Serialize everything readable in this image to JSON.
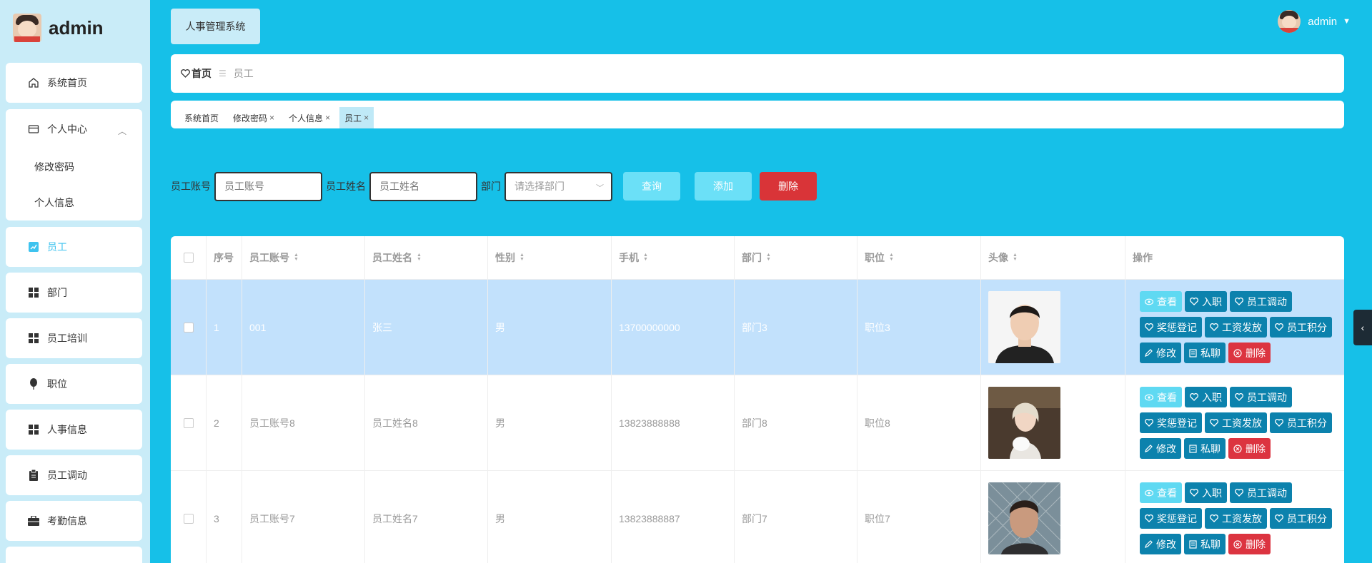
{
  "app": {
    "title": "admin",
    "system_tab": "人事管理系统"
  },
  "user": {
    "name": "admin"
  },
  "sidebar": {
    "items": [
      {
        "label": "系统首页",
        "icon": "home-icon"
      },
      {
        "label": "个人中心",
        "icon": "card-icon",
        "expanded": true,
        "children": [
          "修改密码",
          "个人信息"
        ]
      },
      {
        "label": "员工",
        "icon": "chart-icon",
        "active": true
      },
      {
        "label": "部门",
        "icon": "grid-icon"
      },
      {
        "label": "员工培训",
        "icon": "grid-icon"
      },
      {
        "label": "职位",
        "icon": "balloon-icon"
      },
      {
        "label": "人事信息",
        "icon": "grid-icon"
      },
      {
        "label": "员工调动",
        "icon": "clipboard-icon"
      },
      {
        "label": "考勤信息",
        "icon": "briefcase-icon"
      }
    ]
  },
  "breadcrumb": {
    "home": "首页",
    "separator": "☰",
    "current": "员工"
  },
  "tags": [
    {
      "label": "系统首页",
      "closable": false
    },
    {
      "label": "修改密码",
      "closable": true
    },
    {
      "label": "个人信息",
      "closable": true
    },
    {
      "label": "员工",
      "closable": true,
      "active": true
    }
  ],
  "search": {
    "account_label": "员工账号",
    "account_placeholder": "员工账号",
    "name_label": "员工姓名",
    "name_placeholder": "员工姓名",
    "dept_label": "部门",
    "dept_placeholder": "请选择部门",
    "query_btn": "查询",
    "add_btn": "添加",
    "delete_btn": "删除"
  },
  "table": {
    "columns": [
      "序号",
      "员工账号",
      "员工姓名",
      "性别",
      "手机",
      "部门",
      "职位",
      "头像",
      "操作"
    ],
    "rows": [
      {
        "idx": "1",
        "account": "001",
        "name": "张三",
        "gender": "男",
        "phone": "13700000000",
        "dept": "部门3",
        "position": "职位3",
        "selected": true
      },
      {
        "idx": "2",
        "account": "员工账号8",
        "name": "员工姓名8",
        "gender": "男",
        "phone": "13823888888",
        "dept": "部门8",
        "position": "职位8",
        "selected": false
      },
      {
        "idx": "3",
        "account": "员工账号7",
        "name": "员工姓名7",
        "gender": "男",
        "phone": "13823888887",
        "dept": "部门7",
        "position": "职位7",
        "selected": false
      }
    ],
    "actions": {
      "view": "查看",
      "onboard": "入职",
      "transfer": "员工调动",
      "reward": "奖惩登记",
      "salary": "工资发放",
      "points": "员工积分",
      "edit": "修改",
      "chat": "私聊",
      "delete": "删除"
    }
  },
  "colors": {
    "accent": "#16c0e8",
    "sidebar_bg": "#c9ecf8",
    "action_blue": "#0c82ad",
    "danger": "#d93438",
    "selected_row": "#c2e1fc"
  }
}
